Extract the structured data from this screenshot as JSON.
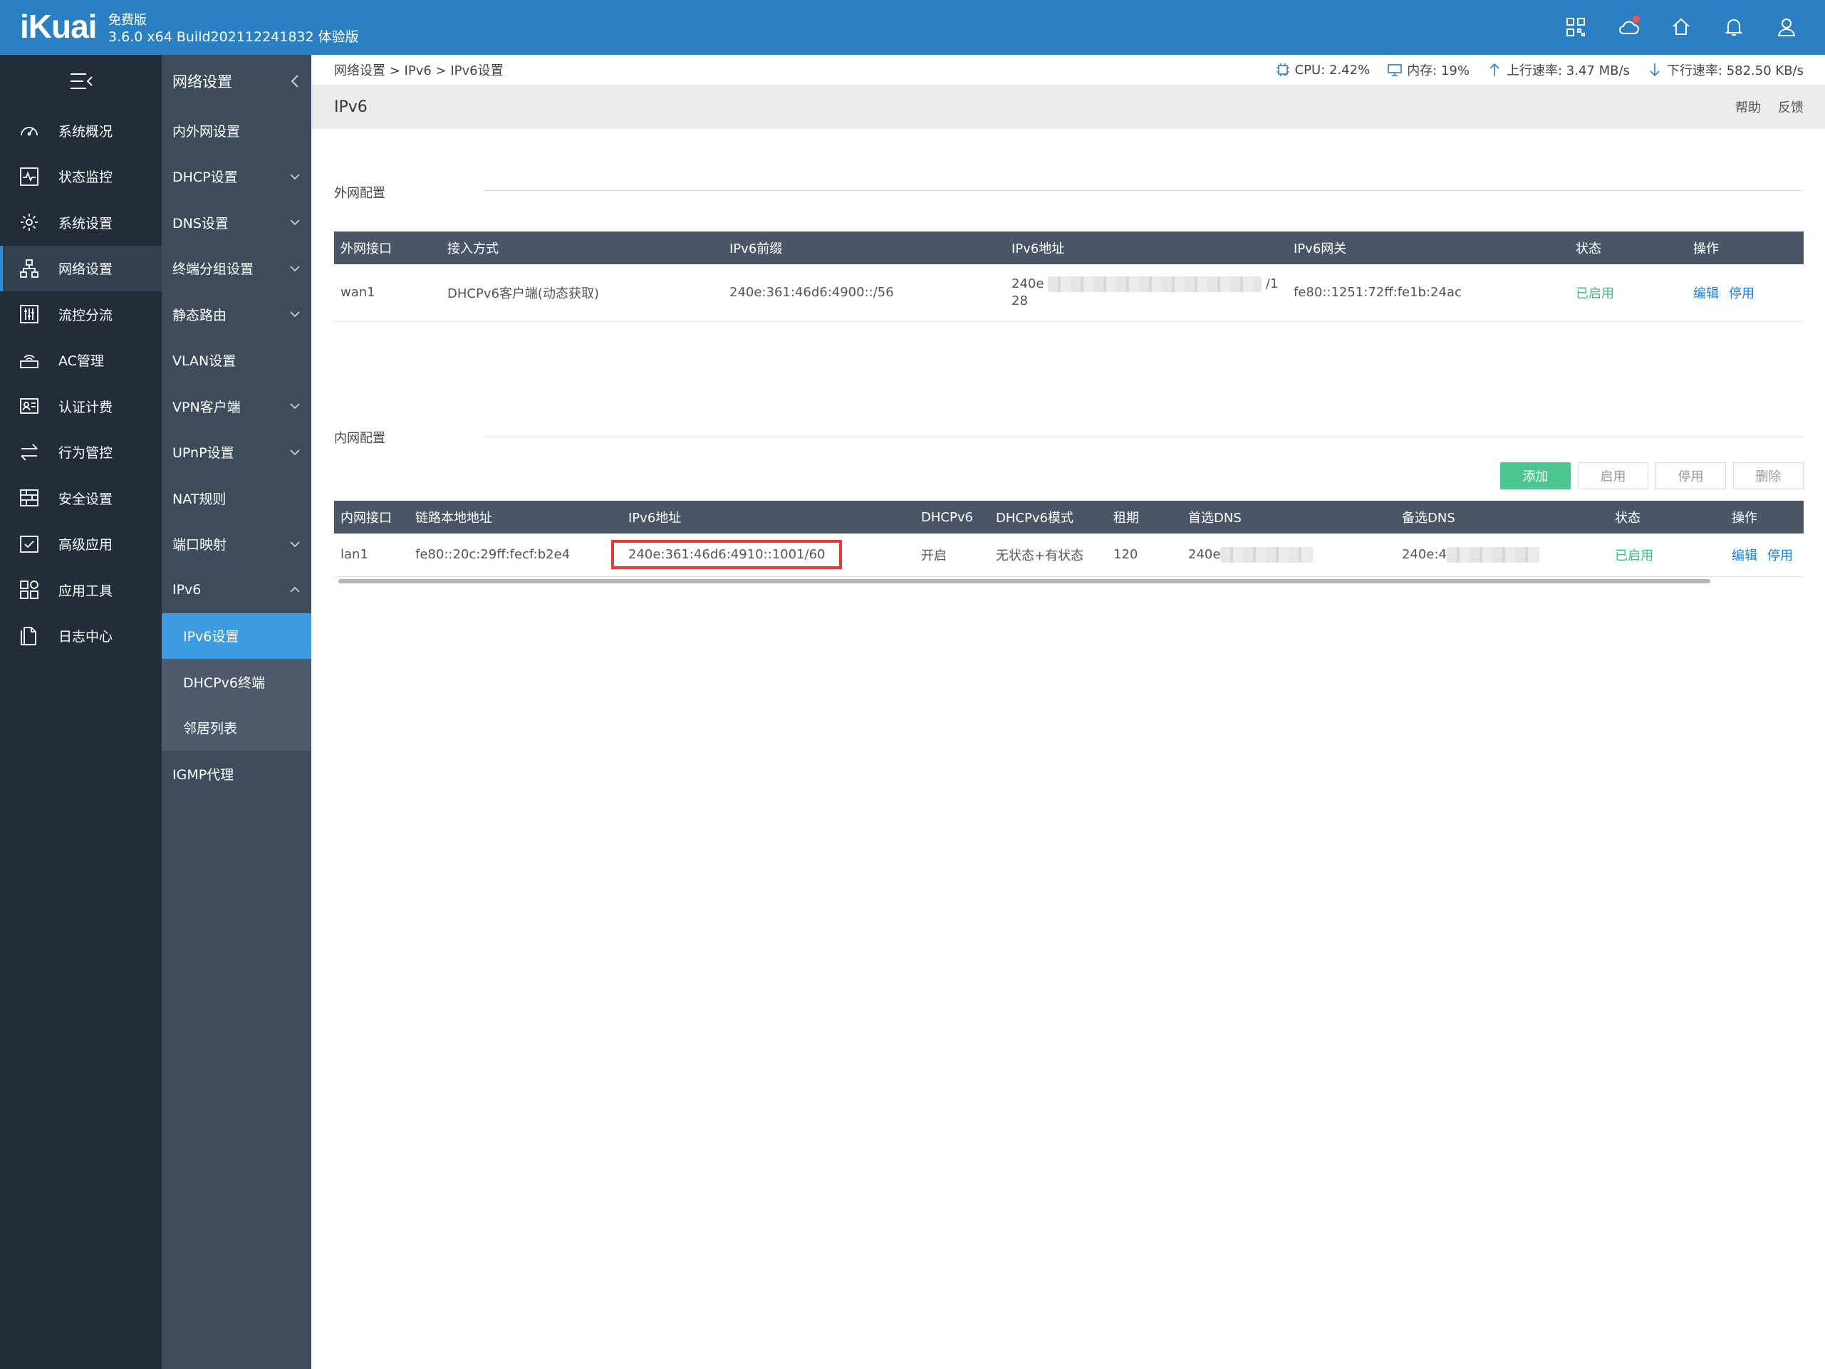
{
  "header": {
    "logo": "iKuai",
    "edition": "免费版",
    "build": "3.6.0 x64 Build202112241832 体验版",
    "icons": [
      "apps-grid-icon",
      "cloud-icon",
      "home-icon",
      "bell-icon",
      "user-icon"
    ]
  },
  "leftnav": {
    "items": [
      {
        "label": "系统概况",
        "icon": "gauge-icon"
      },
      {
        "label": "状态监控",
        "icon": "monitor-chart-icon"
      },
      {
        "label": "系统设置",
        "icon": "gear-icon"
      },
      {
        "label": "网络设置",
        "icon": "network-icon",
        "active": true
      },
      {
        "label": "流控分流",
        "icon": "sliders-icon"
      },
      {
        "label": "AC管理",
        "icon": "wifi-router-icon"
      },
      {
        "label": "认证计费",
        "icon": "id-card-icon"
      },
      {
        "label": "行为管控",
        "icon": "arrows-exchange-icon"
      },
      {
        "label": "安全设置",
        "icon": "firewall-icon"
      },
      {
        "label": "高级应用",
        "icon": "checkbox-icon"
      },
      {
        "label": "应用工具",
        "icon": "tools-grid-icon"
      },
      {
        "label": "日志中心",
        "icon": "document-icon"
      }
    ]
  },
  "subnav": {
    "title": "网络设置",
    "items": [
      {
        "label": "内外网设置",
        "chevron": false
      },
      {
        "label": "DHCP设置",
        "chevron": true
      },
      {
        "label": "DNS设置",
        "chevron": true
      },
      {
        "label": "终端分组设置",
        "chevron": true
      },
      {
        "label": "静态路由",
        "chevron": true
      },
      {
        "label": "VLAN设置",
        "chevron": false
      },
      {
        "label": "VPN客户端",
        "chevron": true
      },
      {
        "label": "UPnP设置",
        "chevron": true
      },
      {
        "label": "NAT规则",
        "chevron": false
      },
      {
        "label": "端口映射",
        "chevron": true
      },
      {
        "label": "IPv6",
        "chevron": true,
        "expanded": true
      }
    ],
    "children": [
      {
        "label": "IPv6设置",
        "active": true
      },
      {
        "label": "DHCPv6终端"
      },
      {
        "label": "邻居列表"
      }
    ],
    "after": [
      {
        "label": "IGMP代理"
      }
    ]
  },
  "breadcrumb": "网络设置 > IPv6 > IPv6设置",
  "stats": {
    "cpu": "CPU: 2.42%",
    "mem": "内存: 19%",
    "up": "上行速率: 3.47 MB/s",
    "down": "下行速率: 582.50 KB/s"
  },
  "page": {
    "title": "IPv6",
    "help": "帮助",
    "feedback": "反馈"
  },
  "wan": {
    "section_title": "外网配置",
    "columns": [
      "外网接口",
      "接入方式",
      "IPv6前缀",
      "IPv6地址",
      "IPv6网关",
      "状态",
      "操作"
    ],
    "rows": [
      {
        "iface": "wan1",
        "mode": "DHCPv6客户端(动态获取)",
        "prefix": "240e:361:46d6:4900::/56",
        "addr_start": "240e",
        "addr_end": "/1",
        "addr_line2": "28",
        "gateway": "fe80::1251:72ff:fe1b:24ac",
        "status": "已启用",
        "edit": "编辑",
        "disable": "停用"
      }
    ]
  },
  "lan": {
    "section_title": "内网配置",
    "buttons": {
      "add": "添加",
      "enable": "启用",
      "disable": "停用",
      "delete": "删除"
    },
    "columns": [
      "内网接口",
      "链路本地地址",
      "IPv6地址",
      "DHCPv6",
      "DHCPv6模式",
      "租期",
      "首选DNS",
      "备选DNS",
      "状态",
      "操作"
    ],
    "rows": [
      {
        "iface": "lan1",
        "link_local": "fe80::20c:29ff:fecf:b2e4",
        "addr": "240e:361:46d6:4910::1001/60",
        "dhcpv6": "开启",
        "mode": "无状态+有状态",
        "lease": "120",
        "dns1": "240e",
        "dns2": "240e:4",
        "status": "已启用",
        "edit": "编辑",
        "disable": "停用"
      }
    ]
  }
}
